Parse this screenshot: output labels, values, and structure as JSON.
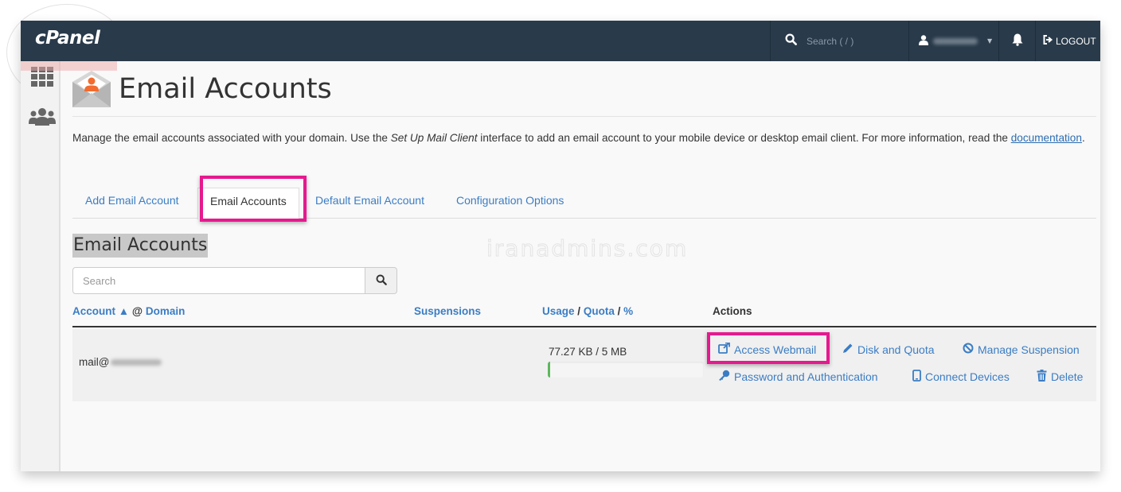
{
  "topbar": {
    "logo": "cPanel",
    "search_placeholder": "Search ( / )",
    "logout_label": "LOGOUT"
  },
  "page": {
    "title": "Email Accounts",
    "description_part1": "Manage the email accounts associated with your domain. Use the ",
    "description_em": "Set Up Mail Client",
    "description_part2": " interface to add an email account to your mobile device or desktop email client. For more information, read the ",
    "description_link": "documentation",
    "description_end": "."
  },
  "tabs": [
    {
      "label": "Add Email Account",
      "active": false
    },
    {
      "label": "Email Accounts",
      "active": true
    },
    {
      "label": "Default Email Account",
      "active": false
    },
    {
      "label": "Configuration Options",
      "active": false
    }
  ],
  "section": {
    "title": "Email Accounts",
    "search_placeholder": "Search"
  },
  "watermark": "iranadmins.com",
  "table": {
    "headers": {
      "account": "Account",
      "sort_arrow": "▲",
      "at": "@",
      "domain": "Domain",
      "suspensions": "Suspensions",
      "usage": "Usage",
      "slash1": "/",
      "quota": "Quota",
      "slash2": "/",
      "percent": "%",
      "actions": "Actions"
    },
    "rows": [
      {
        "account_prefix": "mail@",
        "usage_text": "77.27 KB / 5 MB",
        "usage_fraction": 0.015,
        "actions": {
          "access_webmail": "Access Webmail",
          "disk_quota": "Disk and Quota",
          "manage_suspension": "Manage Suspension",
          "password_auth": "Password and Authentication",
          "connect_devices": "Connect Devices",
          "delete": "Delete"
        }
      }
    ]
  },
  "colors": {
    "topbar": "#293a4a",
    "link": "#3b7dc4",
    "highlight": "#e6198f",
    "progress": "#5cb85c",
    "icon_orange": "#f26b2f"
  }
}
